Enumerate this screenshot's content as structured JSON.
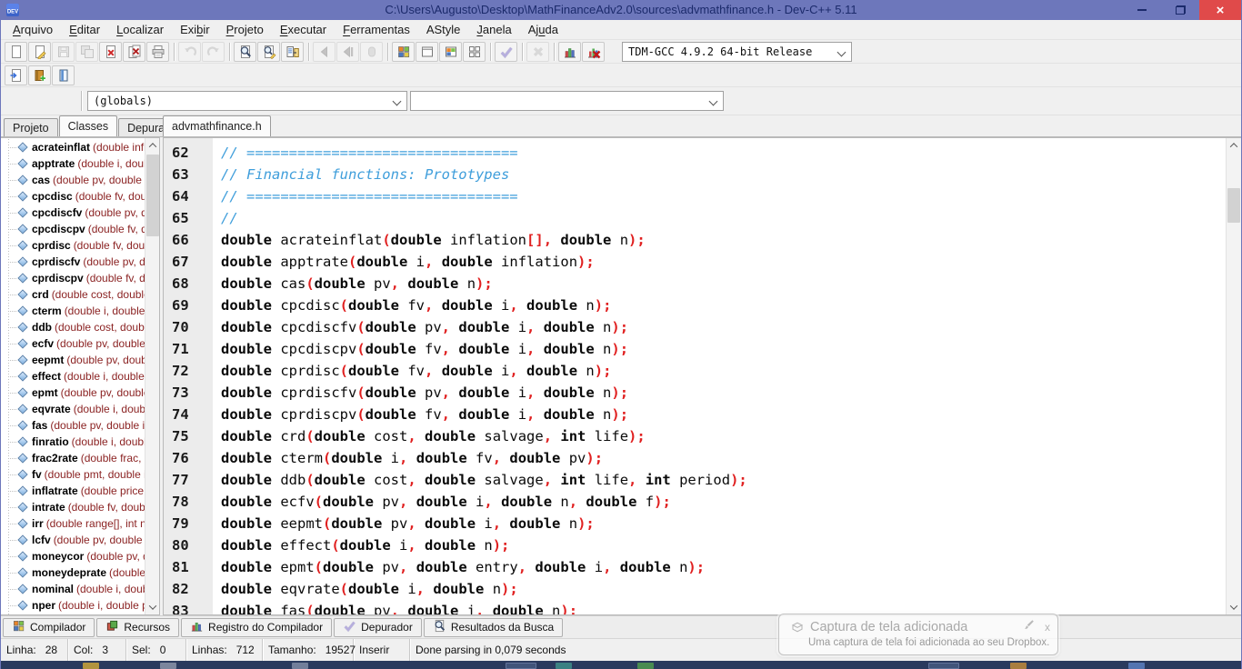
{
  "window": {
    "title": "C:\\Users\\Augusto\\Desktop\\MathFinanceAdv2.0\\sources\\advmathfinance.h - Dev-C++ 5.11",
    "controls": [
      "minimize",
      "restore",
      "close"
    ]
  },
  "menu": {
    "items": [
      "&Arquivo",
      "&Editar",
      "&Localizar",
      "Exi&bir",
      "&Projeto",
      "&Executar",
      "&Ferramentas",
      "AStyle",
      "&Janela",
      "Aj&uda"
    ]
  },
  "toolbar": {
    "row1": [
      {
        "i": "new-file"
      },
      {
        "i": "open-file"
      },
      {
        "i": "save",
        "d": 1
      },
      {
        "i": "save-all",
        "d": 1
      },
      {
        "i": "close-file"
      },
      {
        "i": "close-all"
      },
      {
        "i": "print"
      },
      {
        "sep": 1
      },
      {
        "i": "undo",
        "d": 1
      },
      {
        "i": "redo",
        "d": 1
      },
      {
        "sep": 1
      },
      {
        "i": "find"
      },
      {
        "i": "replace"
      },
      {
        "i": "goto-line"
      },
      {
        "sep": 1
      },
      {
        "i": "back",
        "d": 1
      },
      {
        "i": "forward",
        "d": 1
      },
      {
        "i": "stop",
        "d": 1
      },
      {
        "sep": 1
      },
      {
        "i": "compile"
      },
      {
        "i": "run"
      },
      {
        "i": "compile-run"
      },
      {
        "i": "rebuild"
      },
      {
        "sep": 1
      },
      {
        "i": "syntax-check"
      },
      {
        "sep": 1
      },
      {
        "i": "abort",
        "d": 1
      },
      {
        "sep": 1
      },
      {
        "i": "profile"
      },
      {
        "i": "delete-profile"
      }
    ],
    "row2": [
      {
        "i": "insert"
      },
      {
        "i": "toggle-bookmarks"
      },
      {
        "i": "goto-bookmarks"
      }
    ],
    "compiler_combo": "TDM-GCC 4.9.2 64-bit Release"
  },
  "navigator": {
    "scope_combo": "(globals)",
    "member_combo": ""
  },
  "left_panel": {
    "tabs": [
      "Projeto",
      "Classes",
      "Depurador"
    ],
    "active_tab": "Classes"
  },
  "editor": {
    "tab": "advmathfinance.h",
    "first_line": 62,
    "lines": [
      {
        "n": 62,
        "code": "// ================================"
      },
      {
        "n": 63,
        "code": "// Financial functions: Prototypes"
      },
      {
        "n": 64,
        "code": "// ================================"
      },
      {
        "n": 65,
        "code": "//"
      },
      {
        "n": 66,
        "code": "double acrateinflat(double inflation[], double n);"
      },
      {
        "n": 67,
        "code": "double apptrate(double i, double inflation);"
      },
      {
        "n": 68,
        "code": "double cas(double pv, double n);"
      },
      {
        "n": 69,
        "code": "double cpcdisc(double fv, double i, double n);"
      },
      {
        "n": 70,
        "code": "double cpcdiscfv(double pv, double i, double n);"
      },
      {
        "n": 71,
        "code": "double cpcdiscpv(double fv, double i, double n);"
      },
      {
        "n": 72,
        "code": "double cprdisc(double fv, double i, double n);"
      },
      {
        "n": 73,
        "code": "double cprdiscfv(double pv, double i, double n);"
      },
      {
        "n": 74,
        "code": "double cprdiscpv(double fv, double i, double n);"
      },
      {
        "n": 75,
        "code": "double crd(double cost, double salvage, int life);"
      },
      {
        "n": 76,
        "code": "double cterm(double i, double fv, double pv);"
      },
      {
        "n": 77,
        "code": "double ddb(double cost, double salvage, int life, int period);"
      },
      {
        "n": 78,
        "code": "double ecfv(double pv, double i, double n, double f);"
      },
      {
        "n": 79,
        "code": "double eepmt(double pv, double i, double n);"
      },
      {
        "n": 80,
        "code": "double effect(double i, double n);"
      },
      {
        "n": 81,
        "code": "double epmt(double pv, double entry, double i, double n);"
      },
      {
        "n": 82,
        "code": "double eqvrate(double i, double n);"
      },
      {
        "n": 83,
        "code": "double fas(double pv, double i, double n);"
      }
    ]
  },
  "class_browser": {
    "items": [
      {
        "name": "acrateinflat",
        "params": "(double inflation[], double n)"
      },
      {
        "name": "apptrate",
        "params": "(double i, double inflation)"
      },
      {
        "name": "cas",
        "params": "(double pv, double n)"
      },
      {
        "name": "cpcdisc",
        "params": "(double fv, double i, double n)"
      },
      {
        "name": "cpcdiscfv",
        "params": "(double pv, double i, double n)"
      },
      {
        "name": "cpcdiscpv",
        "params": "(double fv, double i, double n)"
      },
      {
        "name": "cprdisc",
        "params": "(double fv, double i, double n)"
      },
      {
        "name": "cprdiscfv",
        "params": "(double pv, double i, double n)"
      },
      {
        "name": "cprdiscpv",
        "params": "(double fv, double i, double n)"
      },
      {
        "name": "crd",
        "params": "(double cost, double salvage, int life)"
      },
      {
        "name": "cterm",
        "params": "(double i, double fv, double pv)"
      },
      {
        "name": "ddb",
        "params": "(double cost, double salvage, int life, int period)"
      },
      {
        "name": "ecfv",
        "params": "(double pv, double i, double n, double f)"
      },
      {
        "name": "eepmt",
        "params": "(double pv, double i, double n)"
      },
      {
        "name": "effect",
        "params": "(double i, double n)"
      },
      {
        "name": "epmt",
        "params": "(double pv, double entry, double i, double n)"
      },
      {
        "name": "eqvrate",
        "params": "(double i, double n)"
      },
      {
        "name": "fas",
        "params": "(double pv, double i, double n)"
      },
      {
        "name": "finratio",
        "params": "(double i, double n)"
      },
      {
        "name": "frac2rate",
        "params": "(double frac, double n)"
      },
      {
        "name": "fv",
        "params": "(double pmt, double i, double n)"
      },
      {
        "name": "inflatrate",
        "params": "(double price, double n)"
      },
      {
        "name": "intrate",
        "params": "(double fv, double pv, double n)"
      },
      {
        "name": "irr",
        "params": "(double range[], int n)"
      },
      {
        "name": "lcfv",
        "params": "(double pv, double i, double n)"
      },
      {
        "name": "moneycor",
        "params": "(double pv, double i, double n)"
      },
      {
        "name": "moneydeprate",
        "params": "(double pv, double i)"
      },
      {
        "name": "nominal",
        "params": "(double i, double n)"
      },
      {
        "name": "nper",
        "params": "(double i, double pv, double fv)"
      }
    ]
  },
  "bottom_tabs": [
    {
      "icon": "compile",
      "label": "Compilador"
    },
    {
      "icon": "resources",
      "label": "Recursos"
    },
    {
      "icon": "profile",
      "label": "Registro do Compilador"
    },
    {
      "icon": "syntax-check",
      "label": "Depurador"
    },
    {
      "icon": "find",
      "label": "Resultados da Busca"
    }
  ],
  "status_bar": {
    "fields": [
      {
        "label": "Linha:",
        "value": "28"
      },
      {
        "label": "Col:",
        "value": "3"
      },
      {
        "label": "Sel:",
        "value": "0"
      },
      {
        "label": "Linhas:",
        "value": "712"
      },
      {
        "label": "Tamanho:",
        "value": "19527"
      },
      {
        "label": "Inserir",
        "value": ""
      },
      {
        "label": "Done parsing in 0,079 seconds",
        "value": ""
      }
    ]
  },
  "notification": {
    "title": "Captura de tela adicionada",
    "message": "Uma captura de tela foi adicionada ao seu Dropbox.",
    "close_label": "x"
  },
  "colors": {
    "titlebar": "#6d77bb",
    "title_text": "#1b2a6b",
    "close_button": "#e04a4a",
    "comment": "#3f9edb",
    "punctuation": "#e02020",
    "params_maroon": "#8b2323",
    "chrome": "#f0f0f0"
  },
  "icon_names": [
    "devcpp-logo",
    "new-file",
    "open-file",
    "save",
    "save-all",
    "close-file",
    "close-all",
    "print",
    "undo",
    "redo",
    "find",
    "replace",
    "goto-line",
    "back",
    "forward",
    "stop",
    "compile",
    "run",
    "compile-run",
    "rebuild",
    "syntax-check",
    "abort",
    "profile",
    "delete-profile",
    "insert",
    "toggle-bookmarks",
    "goto-bookmarks",
    "resources",
    "dropbox-box",
    "brush",
    "close"
  ]
}
